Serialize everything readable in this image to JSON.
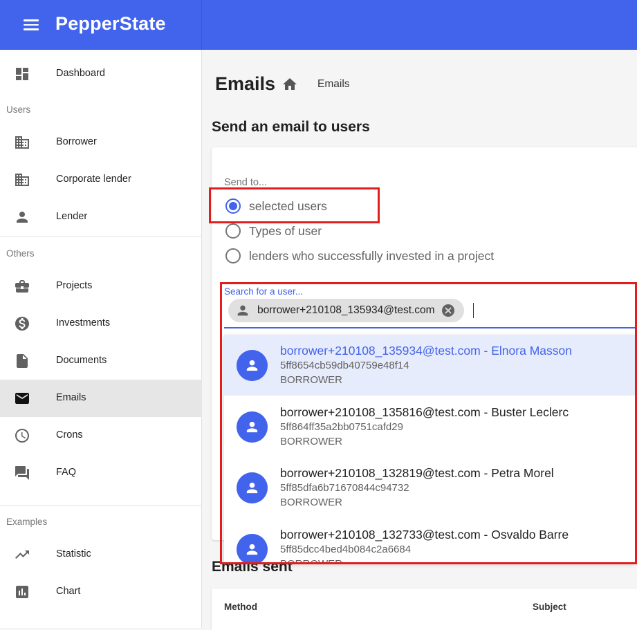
{
  "app": {
    "brand": "PepperState"
  },
  "sidebar": {
    "items_top": [
      {
        "label": "Dashboard",
        "icon": "dashboard-icon"
      }
    ],
    "sections": [
      {
        "label": "Users",
        "items": [
          {
            "label": "Borrower",
            "icon": "building-icon"
          },
          {
            "label": "Corporate lender",
            "icon": "building-icon"
          },
          {
            "label": "Lender",
            "icon": "person-icon"
          }
        ]
      },
      {
        "label": "Others",
        "items": [
          {
            "label": "Projects",
            "icon": "briefcase-icon"
          },
          {
            "label": "Investments",
            "icon": "dollar-icon"
          },
          {
            "label": "Documents",
            "icon": "document-icon"
          },
          {
            "label": "Emails",
            "icon": "mail-icon",
            "active": true
          },
          {
            "label": "Crons",
            "icon": "clock-icon"
          },
          {
            "label": "FAQ",
            "icon": "forum-icon"
          }
        ]
      },
      {
        "label": "Examples",
        "items": [
          {
            "label": "Statistic",
            "icon": "trending-up-icon"
          },
          {
            "label": "Chart",
            "icon": "bar-chart-icon"
          }
        ]
      }
    ]
  },
  "main": {
    "title": "Emails",
    "breadcrumb": "Emails",
    "send_section_title": "Send an email to users",
    "send_to_label": "Send to...",
    "radio_options": [
      {
        "label": "selected users",
        "checked": true
      },
      {
        "label": "Types of user",
        "checked": false
      },
      {
        "label": "lenders who successfully invested in a project",
        "checked": false
      }
    ],
    "search": {
      "label": "Search for a user...",
      "chip": "borrower+210108_135934@test.com"
    },
    "results": [
      {
        "title": "borrower+210108_135934@test.com - Elnora Masson",
        "id": "5ff8654cb59db40759e48f14",
        "role": "BORROWER",
        "selected": true
      },
      {
        "title": "borrower+210108_135816@test.com - Buster Leclerc",
        "id": "5ff864ff35a2bb0751cafd29",
        "role": "BORROWER"
      },
      {
        "title": "borrower+210108_132819@test.com - Petra Morel",
        "id": "5ff85dfa6b71670844c94732",
        "role": "BORROWER"
      },
      {
        "title": "borrower+210108_132733@test.com - Osvaldo Barre",
        "id": "5ff85dcc4bed4b084c2a6684",
        "role": "BORROWER"
      }
    ],
    "sent_title": "Emails sent",
    "table_headers": {
      "method": "Method",
      "subject": "Subject"
    }
  },
  "colors": {
    "accent": "#4263eb",
    "highlight": "#e01e1e",
    "selected_bg": "#e7ecfc"
  }
}
